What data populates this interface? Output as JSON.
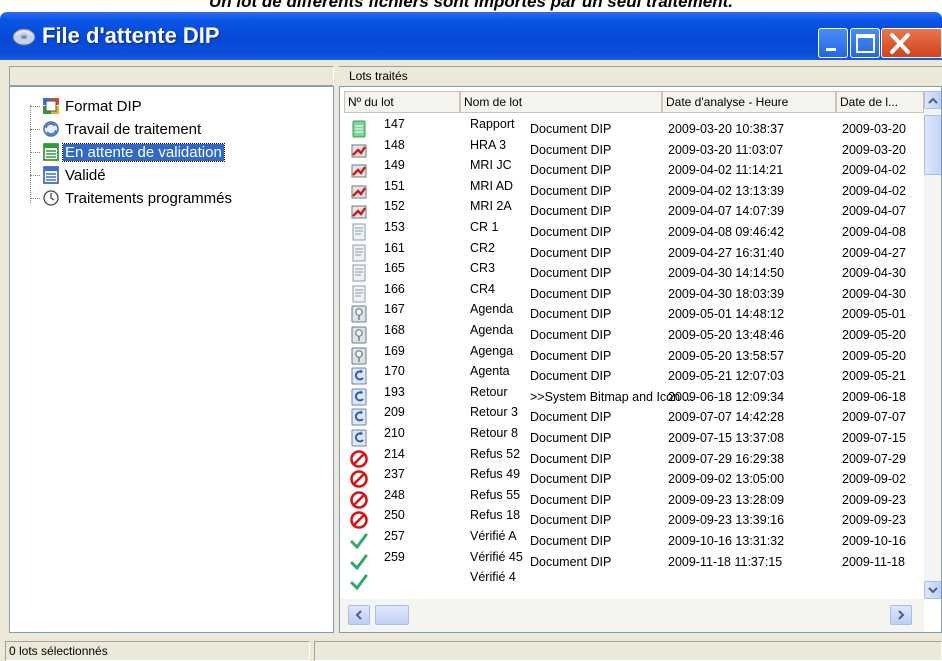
{
  "caption": "Un lot de différents fichiers sont importés par un seul traitement.",
  "window": {
    "title": "File d'attente DIP",
    "icons": {
      "app": "disc-icon",
      "minimize": "minimize-icon",
      "maximize": "maximize-icon",
      "close": "close-icon"
    }
  },
  "tree": {
    "items": [
      {
        "label": "Format DIP",
        "icon": "format-icon",
        "selected": false
      },
      {
        "label": "Travail de traitement",
        "icon": "refresh-icon",
        "selected": false
      },
      {
        "label": "En attente de validation",
        "icon": "pending-list-icon",
        "selected": true
      },
      {
        "label": "Validé",
        "icon": "validated-list-icon",
        "selected": false
      },
      {
        "label": "Traitements programmés",
        "icon": "clock-icon",
        "selected": false
      }
    ]
  },
  "list": {
    "header": "Lots traités",
    "columns": [
      "Nº du lot",
      "Nom de lot",
      "Date d'analyse - Heure",
      "Date de l..."
    ],
    "rows": [
      {
        "icon": "report-icon",
        "num": "147",
        "name": "Rapport",
        "doc": "Document DIP",
        "date": "2009-03-20  10:38:37",
        "date2": "2009-03-20"
      },
      {
        "icon": "mri-icon",
        "num": "148",
        "name": "HRA 3",
        "doc": "Document DIP",
        "date": "2009-03-20  11:03:07",
        "date2": "2009-03-20"
      },
      {
        "icon": "mri-icon",
        "num": "149",
        "name": "MRI JC",
        "doc": "Document DIP",
        "date": "2009-04-02  11:14:21",
        "date2": "2009-04-02"
      },
      {
        "icon": "mri-icon",
        "num": "151",
        "name": "MRI AD",
        "doc": "Document DIP",
        "date": "2009-04-02  13:13:39",
        "date2": "2009-04-02"
      },
      {
        "icon": "mri-icon",
        "num": "152",
        "name": "MRI 2A",
        "doc": "Document DIP",
        "date": "2009-04-07  14:07:39",
        "date2": "2009-04-07"
      },
      {
        "icon": "document-icon",
        "num": "153",
        "name": "CR 1",
        "doc": "Document DIP",
        "date": "2009-04-08  09:46:42",
        "date2": "2009-04-08"
      },
      {
        "icon": "document-icon",
        "num": "161",
        "name": "CR2",
        "doc": "Document DIP",
        "date": "2009-04-27  16:31:40",
        "date2": "2009-04-27"
      },
      {
        "icon": "document-icon",
        "num": "165",
        "name": "CR3",
        "doc": "Document DIP",
        "date": "2009-04-30  14:14:50",
        "date2": "2009-04-30"
      },
      {
        "icon": "document-icon",
        "num": "166",
        "name": "CR4",
        "doc": "Document DIP",
        "date": "2009-04-30  18:03:39",
        "date2": "2009-04-30"
      },
      {
        "icon": "agenda-icon",
        "num": "167",
        "name": "Agenda",
        "doc": "Document DIP",
        "date": "2009-05-01  14:48:12",
        "date2": "2009-05-01"
      },
      {
        "icon": "agenda-icon",
        "num": "168",
        "name": "Agenda",
        "doc": "Document DIP",
        "date": "2009-05-20  13:48:46",
        "date2": "2009-05-20"
      },
      {
        "icon": "agenda-icon",
        "num": "169",
        "name": "Agenga",
        "doc": "Document DIP",
        "date": "2009-05-20  13:58:57",
        "date2": "2009-05-20"
      },
      {
        "icon": "return-icon",
        "num": "170",
        "name": "Agenta",
        "doc": "Document DIP",
        "date": "2009-05-21  12:07:03",
        "date2": "2009-05-21"
      },
      {
        "icon": "return-icon",
        "num": "193",
        "name": "Retour",
        "doc": ">>System Bitmap and Icon ...",
        "date": "2009-06-18  12:09:34",
        "date2": "2009-06-18"
      },
      {
        "icon": "return-icon",
        "num": "209",
        "name": "Retour 3",
        "doc": "Document DIP",
        "date": "2009-07-07  14:42:28",
        "date2": "2009-07-07"
      },
      {
        "icon": "return-icon",
        "num": "210",
        "name": "Retour 8",
        "doc": "Document DIP",
        "date": "2009-07-15  13:37:08",
        "date2": "2009-07-15"
      },
      {
        "icon": "refused-icon",
        "num": "214",
        "name": "Refus 52",
        "doc": "Document DIP",
        "date": "2009-07-29  16:29:38",
        "date2": "2009-07-29"
      },
      {
        "icon": "refused-icon",
        "num": "237",
        "name": "Refus 49",
        "doc": "Document DIP",
        "date": "2009-09-02  13:05:00",
        "date2": "2009-09-02"
      },
      {
        "icon": "refused-icon",
        "num": "248",
        "name": "Refus 55",
        "doc": "Document DIP",
        "date": "2009-09-23  13:28:09",
        "date2": "2009-09-23"
      },
      {
        "icon": "refused-icon",
        "num": "250",
        "name": "Refus 18",
        "doc": "Document DIP",
        "date": "2009-09-23  13:39:16",
        "date2": "2009-09-23"
      },
      {
        "icon": "verified-icon",
        "num": "257",
        "name": "Vérifié A",
        "doc": "Document DIP",
        "date": "2009-10-16  13:31:32",
        "date2": "2009-10-16"
      },
      {
        "icon": "verified-icon",
        "num": "259",
        "name": "Vérifié 45",
        "doc": "Document DIP",
        "date": "2009-11-18  11:37:15",
        "date2": "2009-11-18"
      },
      {
        "icon": "verified-icon",
        "num": "",
        "name": "Vérifié 4",
        "doc": "",
        "date": "",
        "date2": ""
      }
    ]
  },
  "status": {
    "left": "0 lots sélectionnés",
    "right": ""
  }
}
